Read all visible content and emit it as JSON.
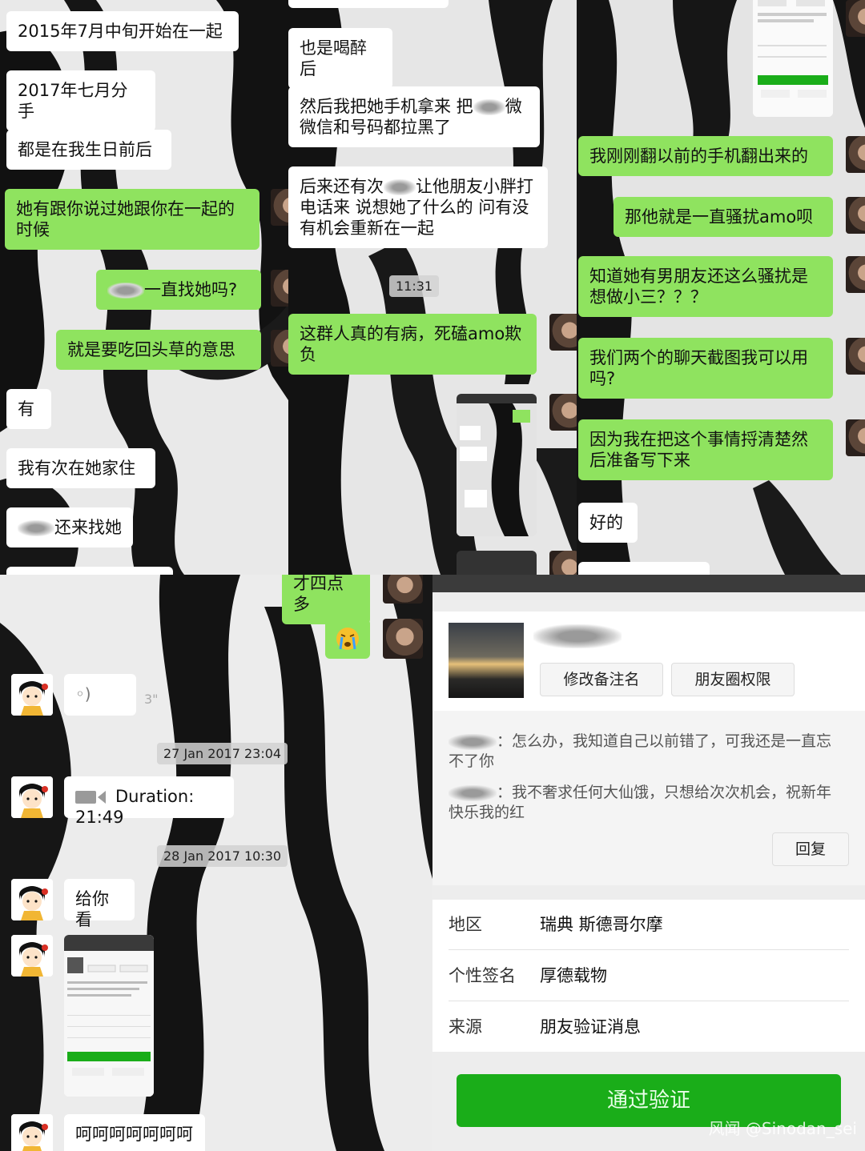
{
  "panel_top_left": {
    "messages": [
      {
        "text": "2015年7月中旬开始在一起",
        "side": "left"
      },
      {
        "text": "2017年七月分手",
        "side": "left"
      },
      {
        "text": "都是在我生日前后",
        "side": "left"
      },
      {
        "text": "她有跟你说过她跟你在一起的时候",
        "side": "right"
      },
      {
        "text": "一直找她吗?",
        "side": "right"
      },
      {
        "text": "就是要吃回头草的意思",
        "side": "right"
      },
      {
        "text": "有",
        "side": "left"
      },
      {
        "text": "我有次在她家住",
        "side": "left"
      },
      {
        "text": "还来找她",
        "side": "left"
      }
    ]
  },
  "panel_top_middle": {
    "messages": [
      {
        "text": "也是喝醉后",
        "side": "left"
      },
      {
        "text": "然后我把她手机拿来 把",
        "text2": "微信和号码都拉黑了",
        "side": "left"
      },
      {
        "text": "后来还有次",
        "text2": "让他朋友小胖打电话来 说想她了什么的 问有没有机会重新在一起",
        "side": "left"
      },
      {
        "text": "这群人真的有病，死磕amo欺负",
        "side": "right"
      }
    ],
    "time": "11:31"
  },
  "panel_top_right": {
    "messages": [
      {
        "text": "我刚刚翻以前的手机翻出来的",
        "side": "right"
      },
      {
        "text": "那他就是一直骚扰amo呗",
        "side": "right"
      },
      {
        "text": "知道她有男朋友还这么骚扰是想做小三？？？",
        "side": "right"
      },
      {
        "text": "我们两个的聊天截图我可以用吗?",
        "side": "right"
      },
      {
        "text": "因为我在把这个事情捋清楚然后准备写下来",
        "side": "right"
      },
      {
        "text": "好的",
        "side": "left"
      }
    ]
  },
  "panel_bottom_left": {
    "top_msg": "才四点多",
    "voice_duration": "3\"",
    "time1": "27 Jan 2017 23:04",
    "call_label": "Duration: 21:49",
    "time2": "28 Jan 2017 10:30",
    "msg_show": "给你看",
    "msg_laugh": "呵呵呵呵呵呵呵"
  },
  "panel_bottom_right": {
    "edit_remark": "修改备注名",
    "moments_perm": "朋友圈权限",
    "request_line1_prefix": "：",
    "request_line1": "怎么办，我知道自己以前错了，可我还是一直忘不了你",
    "request_line2": "我不奢求任何大仙饿，只想给次次机会，祝新年快乐我的红",
    "reply": "回复",
    "rows": [
      {
        "key": "地区",
        "value": "瑞典 斯德哥尔摩"
      },
      {
        "key": "个性签名",
        "value": "厚德载物"
      },
      {
        "key": "来源",
        "value": "朋友验证消息"
      }
    ],
    "verify_button": "通过验证",
    "watermark": "风闻 @Sinodan_sei"
  },
  "colors": {
    "bubble_green": "#8fe35f",
    "verify_green": "#1aad19"
  }
}
